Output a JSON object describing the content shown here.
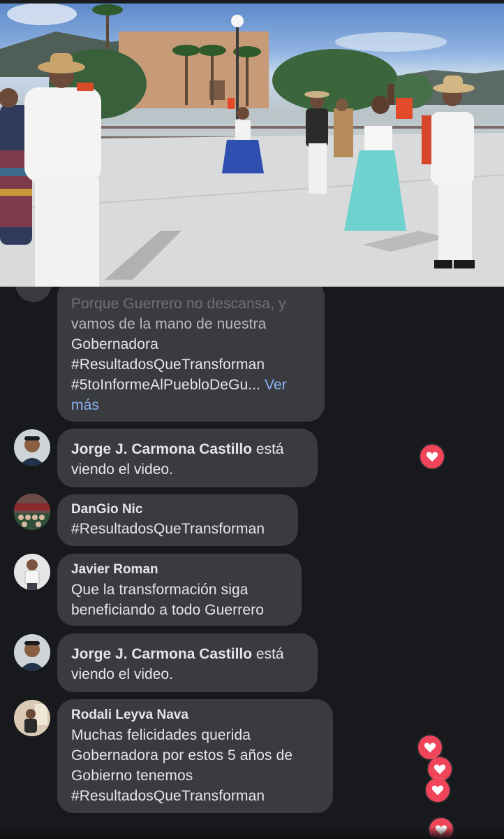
{
  "video": {
    "description_icon": "live-video-dance-performance"
  },
  "comments": [
    {
      "id": "truncated",
      "text_lines": [
        "Porque Guerrero no descansa, y",
        "vamos de la mano de nuestra",
        "Gobernadora",
        "#ResultadosQueTransforman",
        "#5toInformeAlPuebloDeGu..."
      ],
      "see_more": "Ver más",
      "see_more_1": "Ver",
      "see_more_2": "más"
    },
    {
      "id": "c1",
      "name": "Jorge J. Carmona Castillo",
      "suffix": "está",
      "line2": "viendo el video."
    },
    {
      "id": "c2",
      "name": "DanGio Nic",
      "text": "#ResultadosQueTransforman"
    },
    {
      "id": "c3",
      "name": "Javier Roman",
      "line1": "Que la transformación siga",
      "line2": "beneficiando a todo Guerrero"
    },
    {
      "id": "c4",
      "name": "Jorge J. Carmona Castillo",
      "suffix": "está",
      "line2": "viendo el video."
    },
    {
      "id": "c5",
      "name": "Rodali Leyva Nava",
      "lines": [
        "Muchas felicidades querida",
        "Gobernadora por estos 5 años de",
        "Gobierno tenemos",
        "#ResultadosQueTransforman"
      ]
    }
  ],
  "colors": {
    "background": "#18191c",
    "bubble": "#3a3b3f",
    "text": "#e4e6eb",
    "link": "#8ab4f8",
    "heart": "#f0445a"
  },
  "reactions": [
    "heart-icon",
    "heart-icon",
    "heart-icon",
    "heart-icon",
    "heart-icon"
  ]
}
